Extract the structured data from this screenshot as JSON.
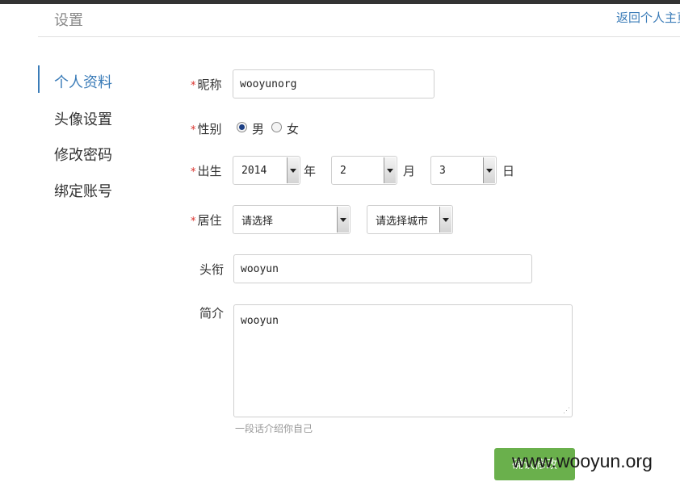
{
  "header": {
    "title": "设置",
    "back_link": "返回个人主页"
  },
  "sidebar": {
    "items": [
      {
        "label": "个人资料",
        "active": true
      },
      {
        "label": "头像设置",
        "active": false
      },
      {
        "label": "修改密码",
        "active": false
      },
      {
        "label": "绑定账号",
        "active": false
      }
    ]
  },
  "form": {
    "required_mark": "*",
    "nickname": {
      "label": "昵称",
      "value": "wooyunorg"
    },
    "gender": {
      "label": "性别",
      "options": [
        {
          "label": "男",
          "checked": true
        },
        {
          "label": "女",
          "checked": false
        }
      ]
    },
    "birth": {
      "label": "出生",
      "year": {
        "value": "2014",
        "unit": "年"
      },
      "month": {
        "value": "2",
        "unit": "月"
      },
      "day": {
        "value": "3",
        "unit": "日"
      }
    },
    "residence": {
      "label": "居住",
      "province": "请选择",
      "city": "请选择城市"
    },
    "headline": {
      "label": "头衔",
      "value": "wooyun"
    },
    "bio": {
      "label": "简介",
      "value": "wooyun",
      "hint": "一段话介绍你自己"
    },
    "save_label": "确认修改"
  },
  "watermark": "www.wooyun.org",
  "colors": {
    "accent": "#3b7cb8",
    "required": "#d9302b",
    "button": "#6ab04c"
  }
}
